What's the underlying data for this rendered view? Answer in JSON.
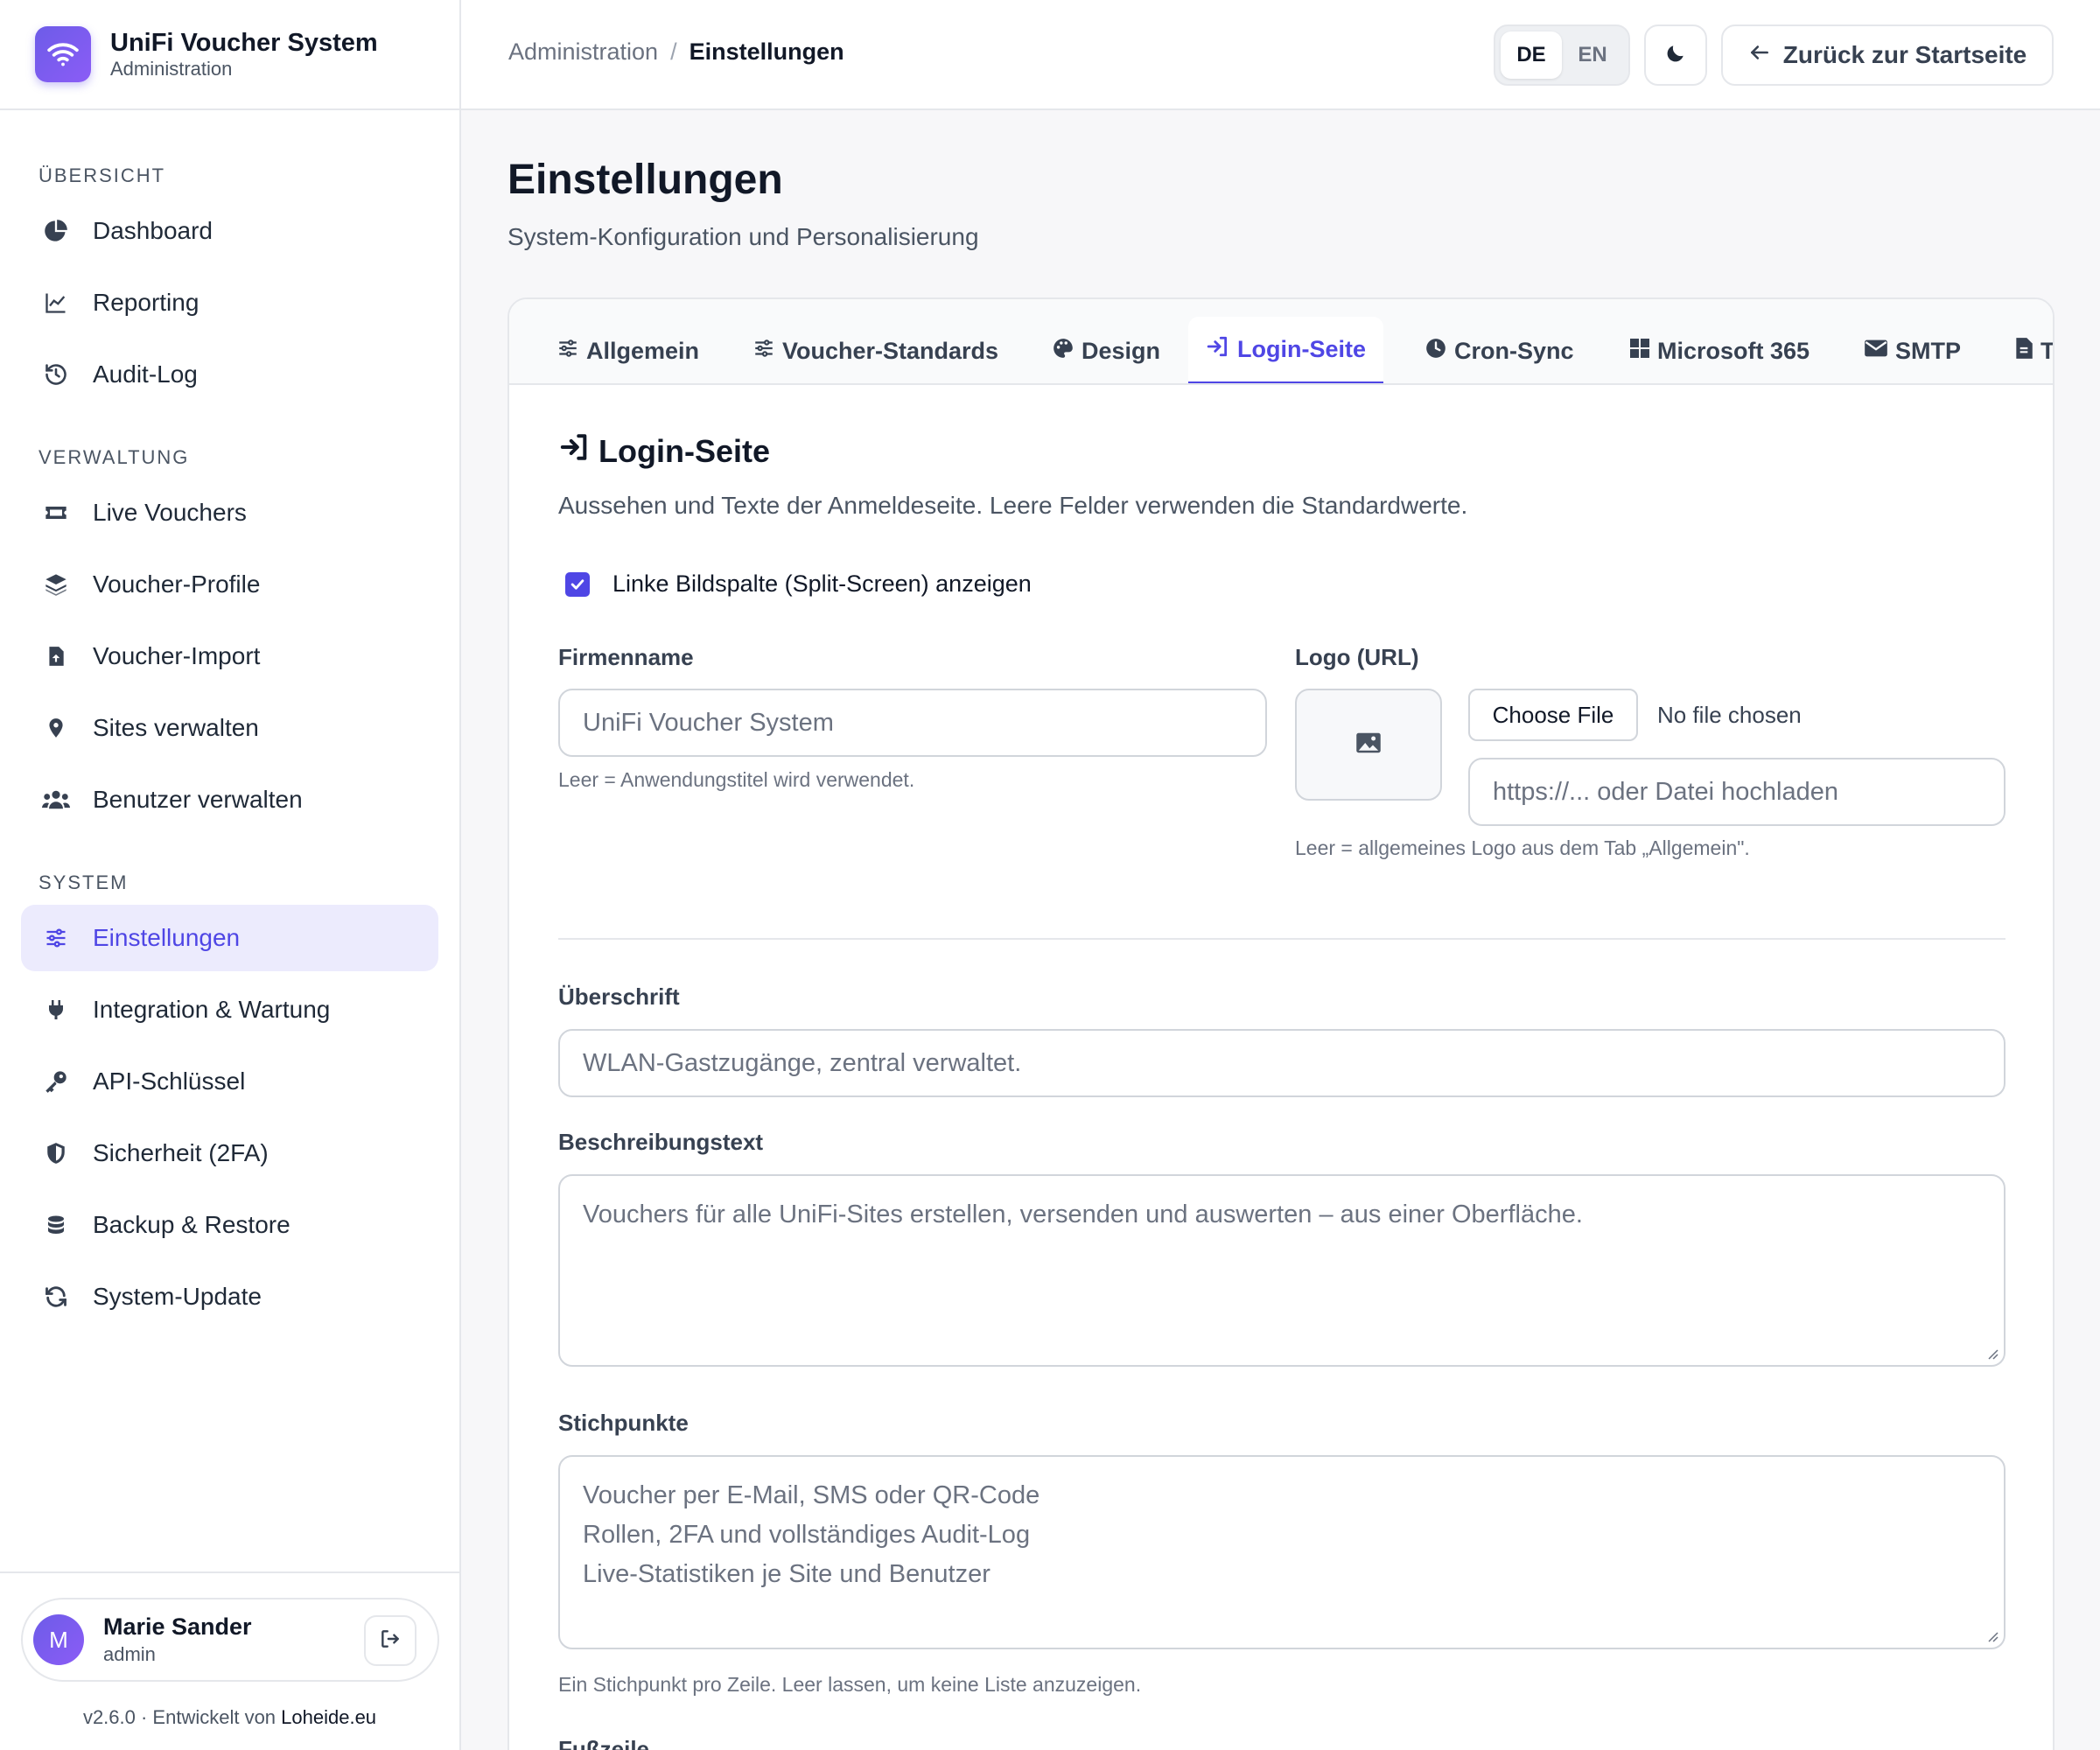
{
  "brand": {
    "title": "UniFi Voucher System",
    "subtitle": "Administration"
  },
  "sidebar": {
    "sections": [
      {
        "title": "ÜBERSICHT",
        "items": [
          {
            "label": "Dashboard",
            "icon": "pie-chart-icon"
          },
          {
            "label": "Reporting",
            "icon": "line-chart-icon"
          },
          {
            "label": "Audit-Log",
            "icon": "history-icon"
          }
        ]
      },
      {
        "title": "VERWALTUNG",
        "items": [
          {
            "label": "Live Vouchers",
            "icon": "ticket-icon"
          },
          {
            "label": "Voucher-Profile",
            "icon": "layers-icon"
          },
          {
            "label": "Voucher-Import",
            "icon": "file-upload-icon"
          },
          {
            "label": "Sites verwalten",
            "icon": "map-pin-icon"
          },
          {
            "label": "Benutzer verwalten",
            "icon": "users-icon"
          }
        ]
      },
      {
        "title": "SYSTEM",
        "items": [
          {
            "label": "Einstellungen",
            "icon": "sliders-icon",
            "active": true
          },
          {
            "label": "Integration & Wartung",
            "icon": "plug-icon"
          },
          {
            "label": "API-Schlüssel",
            "icon": "key-icon"
          },
          {
            "label": "Sicherheit (2FA)",
            "icon": "shield-icon"
          },
          {
            "label": "Backup & Restore",
            "icon": "database-icon"
          },
          {
            "label": "System-Update",
            "icon": "refresh-icon"
          }
        ]
      }
    ]
  },
  "user": {
    "initial": "M",
    "name": "Marie Sander",
    "role": "admin"
  },
  "footer": {
    "version": "v2.6.0 · Entwickelt von ",
    "link": "Loheide.eu"
  },
  "topbar": {
    "breadcrumb_parent": "Administration",
    "breadcrumb_sep": "/",
    "breadcrumb_current": "Einstellungen",
    "lang_de": "DE",
    "lang_en": "EN",
    "back_label": "Zurück zur Startseite"
  },
  "page": {
    "title": "Einstellungen",
    "subtitle": "System-Konfiguration und Personalisierung"
  },
  "tabs": [
    {
      "label": "Allgemein",
      "icon": "sliders-icon"
    },
    {
      "label": "Voucher-Standards",
      "icon": "sliders-icon"
    },
    {
      "label": "Design",
      "icon": "palette-icon"
    },
    {
      "label": "Login-Seite",
      "icon": "sign-in-icon",
      "active": true
    },
    {
      "label": "Cron-Sync",
      "icon": "clock-icon"
    },
    {
      "label": "Microsoft 365",
      "icon": "windows-icon"
    },
    {
      "label": "SMTP",
      "icon": "envelope-icon"
    },
    {
      "label": "Te",
      "icon": "file-icon"
    }
  ],
  "section": {
    "title": "Login-Seite",
    "description": "Aussehen und Texte der Anmeldeseite. Leere Felder verwenden die Standardwerte.",
    "split_screen_label": "Linke Bildspalte (Split-Screen) anzeigen",
    "split_screen_checked": true,
    "company": {
      "label": "Firmenname",
      "placeholder": "UniFi Voucher System",
      "hint": "Leer = Anwendungstitel wird verwendet."
    },
    "logo": {
      "label": "Logo (URL)",
      "file_button": "Choose File",
      "file_status": "No file chosen",
      "placeholder": "https://... oder Datei hochladen",
      "hint": "Leer = allgemeines Logo aus dem Tab „Allgemein\"."
    },
    "heading": {
      "label": "Überschrift",
      "placeholder": "WLAN-Gastzugänge, zentral verwaltet."
    },
    "description_text": {
      "label": "Beschreibungstext",
      "placeholder": "Vouchers für alle UniFi-Sites erstellen, versenden und auswerten – aus einer Oberfläche."
    },
    "bullets": {
      "label": "Stichpunkte",
      "lines": [
        "Voucher per E-Mail, SMS oder QR-Code",
        "Rollen, 2FA und vollständiges Audit-Log",
        "Live-Statistiken je Site und Benutzer"
      ],
      "hint": "Ein Stichpunkt pro Zeile. Leer lassen, um keine Liste anzuzeigen."
    },
    "footer_label": "Fußzeile"
  },
  "colors": {
    "accent": "#4f46e5",
    "accent_bg": "#ecebfd",
    "border": "#e5e7eb"
  }
}
